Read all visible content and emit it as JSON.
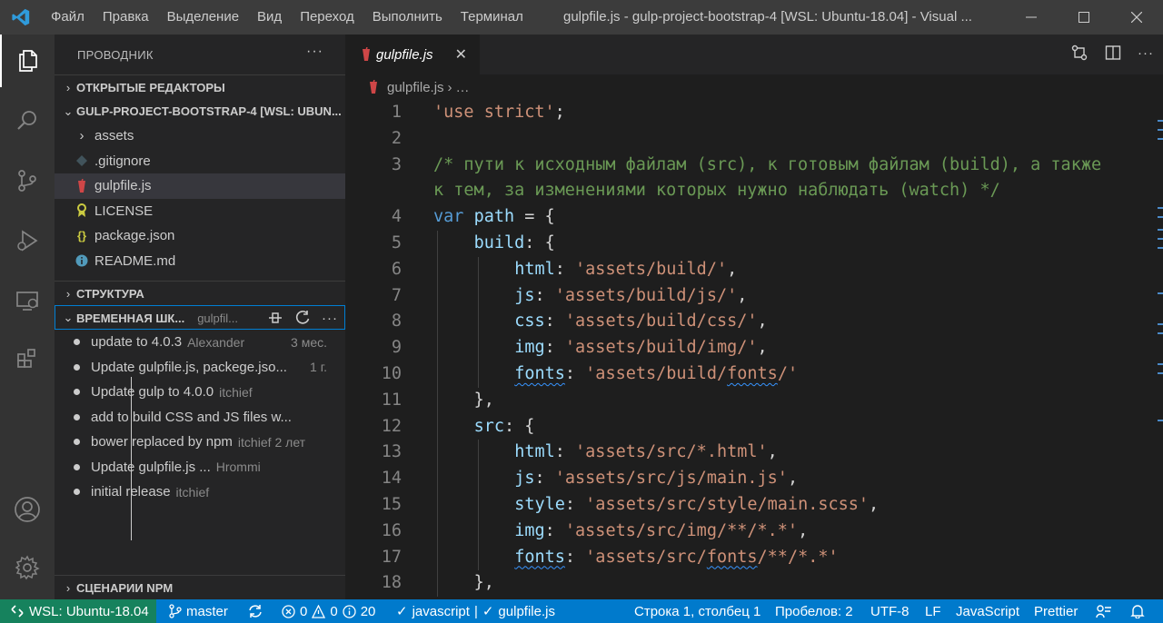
{
  "titlebar": {
    "menu": [
      "Файл",
      "Правка",
      "Выделение",
      "Вид",
      "Переход",
      "Выполнить",
      "Терминал"
    ],
    "title": "gulpfile.js - gulp-project-bootstrap-4 [WSL: Ubuntu-18.04] - Visual ..."
  },
  "activitybar": [
    "files-icon",
    "search-icon",
    "source-control-icon",
    "run-debug-icon",
    "remote-explorer-icon",
    "extensions-icon",
    "account-icon",
    "settings-gear-icon"
  ],
  "sidebar": {
    "header": "ПРОВОДНИК",
    "open_editors": "ОТКРЫТЫЕ РЕДАКТОРЫ",
    "project": "GULP-PROJECT-BOOTSTRAP-4 [WSL: UBUN...",
    "files": [
      {
        "name": "assets",
        "type": "folder"
      },
      {
        "name": ".gitignore",
        "type": "git"
      },
      {
        "name": "gulpfile.js",
        "type": "gulp"
      },
      {
        "name": "LICENSE",
        "type": "license"
      },
      {
        "name": "package.json",
        "type": "json"
      },
      {
        "name": "README.md",
        "type": "info"
      }
    ],
    "outline": "СТРУКТУРА",
    "timeline": "ВРЕМЕННАЯ ШК...",
    "timeline_file": "gulpfil...",
    "timeline_items": [
      {
        "title": "update to 4.0.3",
        "author": "Alexander",
        "time": "3 мес."
      },
      {
        "title": "Update gulpfile.js, packege.jso...",
        "author": "",
        "time": "1 г."
      },
      {
        "title": "Update gulp to 4.0.0",
        "author": "itchief",
        "time": ""
      },
      {
        "title": "add to build CSS and JS files w...",
        "author": "",
        "time": ""
      },
      {
        "title": "bower replaced by npm",
        "author": "itchief",
        "time": "2 лет"
      },
      {
        "title": "Update gulpfile.js ...",
        "author": "Hrommi",
        "time": ""
      },
      {
        "title": "initial release",
        "author": "itchief",
        "time": ""
      }
    ],
    "npm_scripts": "СЦЕНАРИИ NPM"
  },
  "editor": {
    "tab": "gulpfile.js",
    "breadcrumb_file": "gulpfile.js",
    "breadcrumb_rest": "…",
    "lines": [
      {
        "n": "1",
        "indent": 0,
        "tokens": [
          [
            "s",
            "'use strict'"
          ],
          [
            "pn",
            ";"
          ]
        ]
      },
      {
        "n": "2",
        "indent": 0,
        "tokens": []
      },
      {
        "n": "3",
        "indent": 0,
        "tokens": [
          [
            "cm",
            "/* пути к исходным файлам (src), к готовым файлам (build), а также"
          ]
        ]
      },
      {
        "n": "",
        "indent": 0,
        "tokens": [
          [
            "cm",
            "к тем, за изменениями которых нужно наблюдать (watch) */"
          ]
        ]
      },
      {
        "n": "4",
        "indent": 0,
        "tokens": [
          [
            "kw",
            "var"
          ],
          [
            "pn",
            " "
          ],
          [
            "vr",
            "path"
          ],
          [
            "pn",
            " = {"
          ]
        ]
      },
      {
        "n": "5",
        "indent": 1,
        "tokens": [
          [
            "vr",
            "build"
          ],
          [
            "pn",
            ": {"
          ]
        ]
      },
      {
        "n": "6",
        "indent": 2,
        "tokens": [
          [
            "vr",
            "html"
          ],
          [
            "pn",
            ": "
          ],
          [
            "s",
            "'assets/build/'"
          ],
          [
            "pn",
            ","
          ]
        ]
      },
      {
        "n": "7",
        "indent": 2,
        "tokens": [
          [
            "vr",
            "js"
          ],
          [
            "pn",
            ": "
          ],
          [
            "s",
            "'assets/build/js/'"
          ],
          [
            "pn",
            ","
          ]
        ]
      },
      {
        "n": "8",
        "indent": 2,
        "tokens": [
          [
            "vr",
            "css"
          ],
          [
            "pn",
            ": "
          ],
          [
            "s",
            "'assets/build/css/'"
          ],
          [
            "pn",
            ","
          ]
        ]
      },
      {
        "n": "9",
        "indent": 2,
        "tokens": [
          [
            "vr",
            "img"
          ],
          [
            "pn",
            ": "
          ],
          [
            "s",
            "'assets/build/img/'"
          ],
          [
            "pn",
            ","
          ]
        ]
      },
      {
        "n": "10",
        "indent": 2,
        "tokens": [
          [
            "vr sq",
            "fonts"
          ],
          [
            "pn",
            ": "
          ],
          [
            "s",
            "'assets/build/"
          ],
          [
            "s sq",
            "fonts"
          ],
          [
            "s",
            "/'"
          ]
        ]
      },
      {
        "n": "11",
        "indent": 1,
        "tokens": [
          [
            "pn",
            "},"
          ]
        ]
      },
      {
        "n": "12",
        "indent": 1,
        "tokens": [
          [
            "vr",
            "src"
          ],
          [
            "pn",
            ": {"
          ]
        ]
      },
      {
        "n": "13",
        "indent": 2,
        "tokens": [
          [
            "vr",
            "html"
          ],
          [
            "pn",
            ": "
          ],
          [
            "s",
            "'assets/src/*.html'"
          ],
          [
            "pn",
            ","
          ]
        ]
      },
      {
        "n": "14",
        "indent": 2,
        "tokens": [
          [
            "vr",
            "js"
          ],
          [
            "pn",
            ": "
          ],
          [
            "s",
            "'assets/src/js/main.js'"
          ],
          [
            "pn",
            ","
          ]
        ]
      },
      {
        "n": "15",
        "indent": 2,
        "tokens": [
          [
            "vr",
            "style"
          ],
          [
            "pn",
            ": "
          ],
          [
            "s",
            "'assets/src/style/main.scss'"
          ],
          [
            "pn",
            ","
          ]
        ]
      },
      {
        "n": "16",
        "indent": 2,
        "tokens": [
          [
            "vr",
            "img"
          ],
          [
            "pn",
            ": "
          ],
          [
            "s",
            "'assets/src/img/**/*.*'"
          ],
          [
            "pn",
            ","
          ]
        ]
      },
      {
        "n": "17",
        "indent": 2,
        "tokens": [
          [
            "vr sq",
            "fonts"
          ],
          [
            "pn",
            ": "
          ],
          [
            "s",
            "'assets/src/"
          ],
          [
            "s sq",
            "fonts"
          ],
          [
            "s",
            "/**/*.*'"
          ]
        ]
      },
      {
        "n": "18",
        "indent": 1,
        "tokens": [
          [
            "pn",
            "},"
          ]
        ]
      }
    ]
  },
  "statusbar": {
    "remote": "WSL: Ubuntu-18.04",
    "branch": "master",
    "errors": "0",
    "warnings": "0",
    "infos": "20",
    "lint": "javascript",
    "lint_sep": "|",
    "lint_file": "gulpfile.js",
    "position": "Строка 1, столбец 1",
    "spaces": "Пробелов: 2",
    "encoding": "UTF-8",
    "eol": "LF",
    "language": "JavaScript",
    "formatter": "Prettier"
  },
  "colors": {
    "accent": "#007acc",
    "remote": "#16825d",
    "string": "#ce9178",
    "comment": "#6a9955",
    "keyword": "#569cd6",
    "property": "#9cdcfe"
  }
}
